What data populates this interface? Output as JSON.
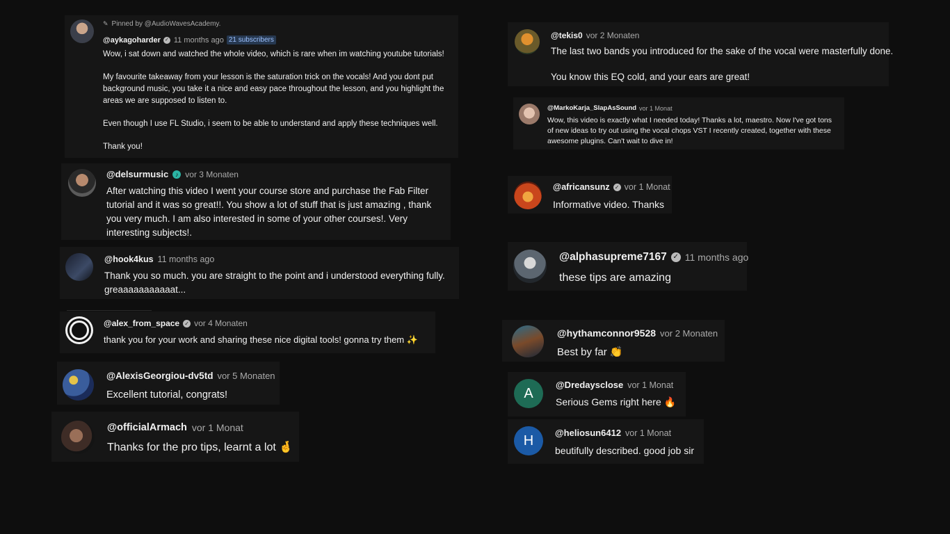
{
  "comments": {
    "c1": {
      "pinned": "Pinned by @AudioWavesAcademy.",
      "handle": "@aykagoharder",
      "time": "11 months ago",
      "subscribers": "21 subscribers",
      "p1": "Wow, i sat down and watched the whole video, which is rare when im watching youtube tutorials!",
      "p2": "My favourite takeaway from your lesson is the saturation trick on the vocals! And you dont put background music, you take it a nice and easy pace throughout the lesson, and you highlight the areas we are supposed to listen to.",
      "p3": "Even though I use FL Studio, i seem to be able to understand and apply these techniques well.",
      "p4": "Thank you!"
    },
    "c2": {
      "handle": "@delsurmusic",
      "time": "vor 3 Monaten",
      "text": "After watching this video I went your course store and purchase the Fab Filter tutorial and it was so great!!. You show a lot of stuff that is just amazing , thank you very much. I am also interested in some of your other courses!. Very interesting subjects!."
    },
    "c3": {
      "handle": "@hook4kus",
      "time": "11 months ago",
      "text": "Thank you so much. you are straight to the point and i understood everything fully. greaaaaaaaaaaat..."
    },
    "c4": {
      "handle": "@alex_from_space",
      "time": "vor 4 Monaten",
      "text": "thank you for your work and sharing these nice digital tools! gonna try them ✨"
    },
    "c5": {
      "handle": "@AlexisGeorgiou-dv5td",
      "time": "vor 5 Monaten",
      "text": "Excellent tutorial, congrats!"
    },
    "c6": {
      "handle": "@officialArmach",
      "time": "vor 1 Monat",
      "text": "Thanks for the pro tips, learnt a lot 🤞"
    },
    "c7": {
      "handle": "@tekis0",
      "time": "vor 2 Monaten",
      "p1": "The last two bands you introduced for the sake of the vocal were masterfully done.",
      "p2": "You know this EQ cold, and your ears are great!"
    },
    "c8": {
      "handle": "@MarkoKarja_SlapAsSound",
      "time": "vor 1 Monat",
      "text": "Wow, this video is exactly what I needed today! Thanks a lot, maestro. Now I've got tons of new ideas to try out using the vocal chops VST I recently created, together with these awesome plugins. Can't wait to dive in!"
    },
    "c9": {
      "handle": "@africansunz",
      "time": "vor 1 Monat",
      "text": "Informative video. Thanks"
    },
    "c10": {
      "handle": "@alphasupreme7167",
      "time": "11 months ago",
      "text": "these tips are amazing"
    },
    "c11": {
      "handle": "@hythamconnor9528",
      "time": "vor 2 Monaten",
      "text": "Best by far 👏"
    },
    "c12": {
      "handle": "@Dredaysclose",
      "time": "vor 1 Monat",
      "text": "Serious Gems right here 🔥",
      "avatar_letter": "A"
    },
    "c13": {
      "handle": "@heliosun6412",
      "time": "vor 1 Monat",
      "text": "beutifully described. good job sir",
      "avatar_letter": "H"
    }
  },
  "icons": {
    "pin": "pin-icon",
    "verified": "checkmark-badge-icon",
    "music_note": "music-note-badge-icon"
  },
  "colors": {
    "background": "#0e0e0e",
    "card": "#161616",
    "secondary_text": "#aaaaaa",
    "subscriber_badge": "#263850",
    "avatar_green": "#1e6b55",
    "avatar_blue": "#1b5aa6"
  }
}
